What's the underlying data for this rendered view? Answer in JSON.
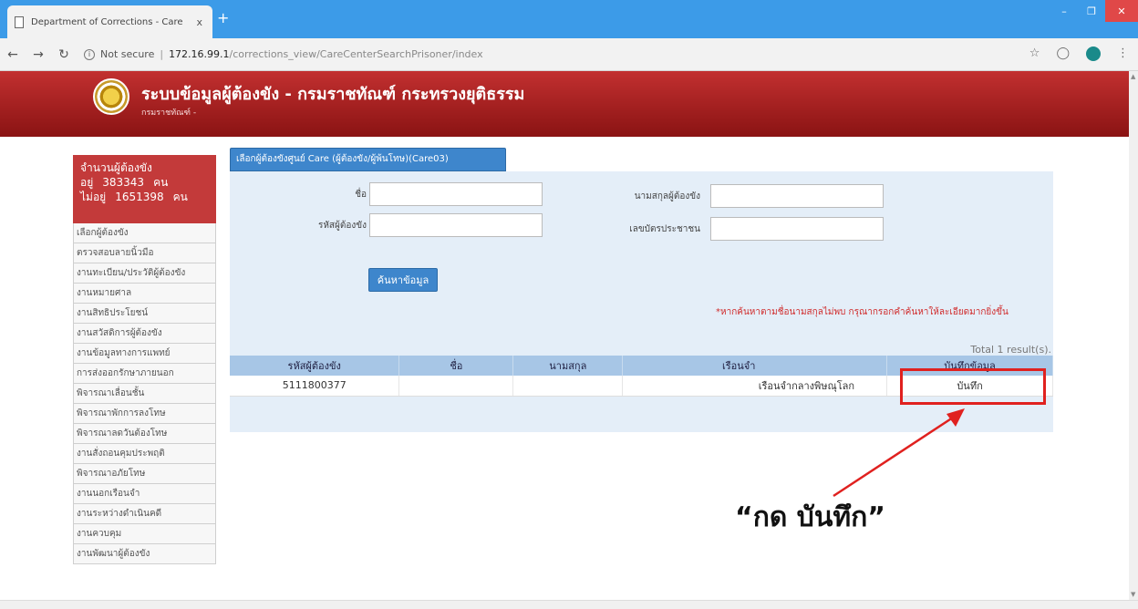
{
  "browser": {
    "tab_title": "Department of Corrections - Care",
    "tab_close": "x",
    "new_tab": "+",
    "url_security": "Not secure",
    "url_host": "172.16.99.1",
    "url_path": "/corrections_view/CareCenterSearchPrisoner/index"
  },
  "banner": {
    "title": "ระบบข้อมูลผู้ต้องขัง - กรมราชทัณฑ์ กระทรวงยุติธรรม",
    "subtitle": "กรมราชทัณฑ์ -"
  },
  "sidebar": {
    "stats_title": "จำนวนผู้ต้องขัง",
    "in_label": "อยู่",
    "in_value": "383343",
    "out_label": "ไม่อยู่",
    "out_value": "1651398",
    "unit": "คน",
    "items": [
      "เลือกผู้ต้องขัง",
      "ตรวจสอบลายนิ้วมือ",
      "งานทะเบียน/ประวัติผู้ต้องขัง",
      "งานหมายศาล",
      "งานสิทธิประโยชน์",
      "งานสวัสดิการผู้ต้องขัง",
      "งานข้อมูลทางการแพทย์",
      "การส่งออกรักษาภายนอก",
      "พิจารณาเลื่อนชั้น",
      "พิจารณาพักการลงโทษ",
      "พิจารณาลดวันต้องโทษ",
      "งานสั่งถอนคุมประพฤติ",
      "พิจารณาอภัยโทษ",
      "งานนอกเรือนจำ",
      "งานระหว่างดำเนินคดี",
      "งานควบคุม",
      "งานพัฒนาผู้ต้องขัง"
    ]
  },
  "panel": {
    "tab_label": "เลือกผู้ต้องขังศูนย์ Care (ผู้ต้องขัง/ผู้พ้นโทษ)(Care03)",
    "name_label": "ชื่อ",
    "name_value": "",
    "surname_label": "นามสกุลผู้ต้องขัง",
    "surname_value": "",
    "id_label": "รหัสผู้ต้องขัง",
    "id_value": "",
    "citizen_label": "เลขบัตรประชาชน",
    "citizen_value": "",
    "search_button": "ค้นหาข้อมูล",
    "note": "*หากค้นหาตามชื่อนามสกุลไม่พบ กรุณากรอกคำค้นหาให้ละเอียดมากยิ่งขึ้น",
    "total": "Total 1 result(s)."
  },
  "results": {
    "headers": [
      "รหัสผู้ต้องขัง",
      "ชื่อ",
      "นามสกุล",
      "เรือนจำ",
      "บันทึกข้อมูล"
    ],
    "rows": [
      [
        "5111800377",
        "",
        "",
        "เรือนจำกลางพิษณุโลก",
        "บันทึก"
      ]
    ]
  },
  "annotation": {
    "text": "“กด บันทึก”",
    "color": "#e0211f"
  }
}
